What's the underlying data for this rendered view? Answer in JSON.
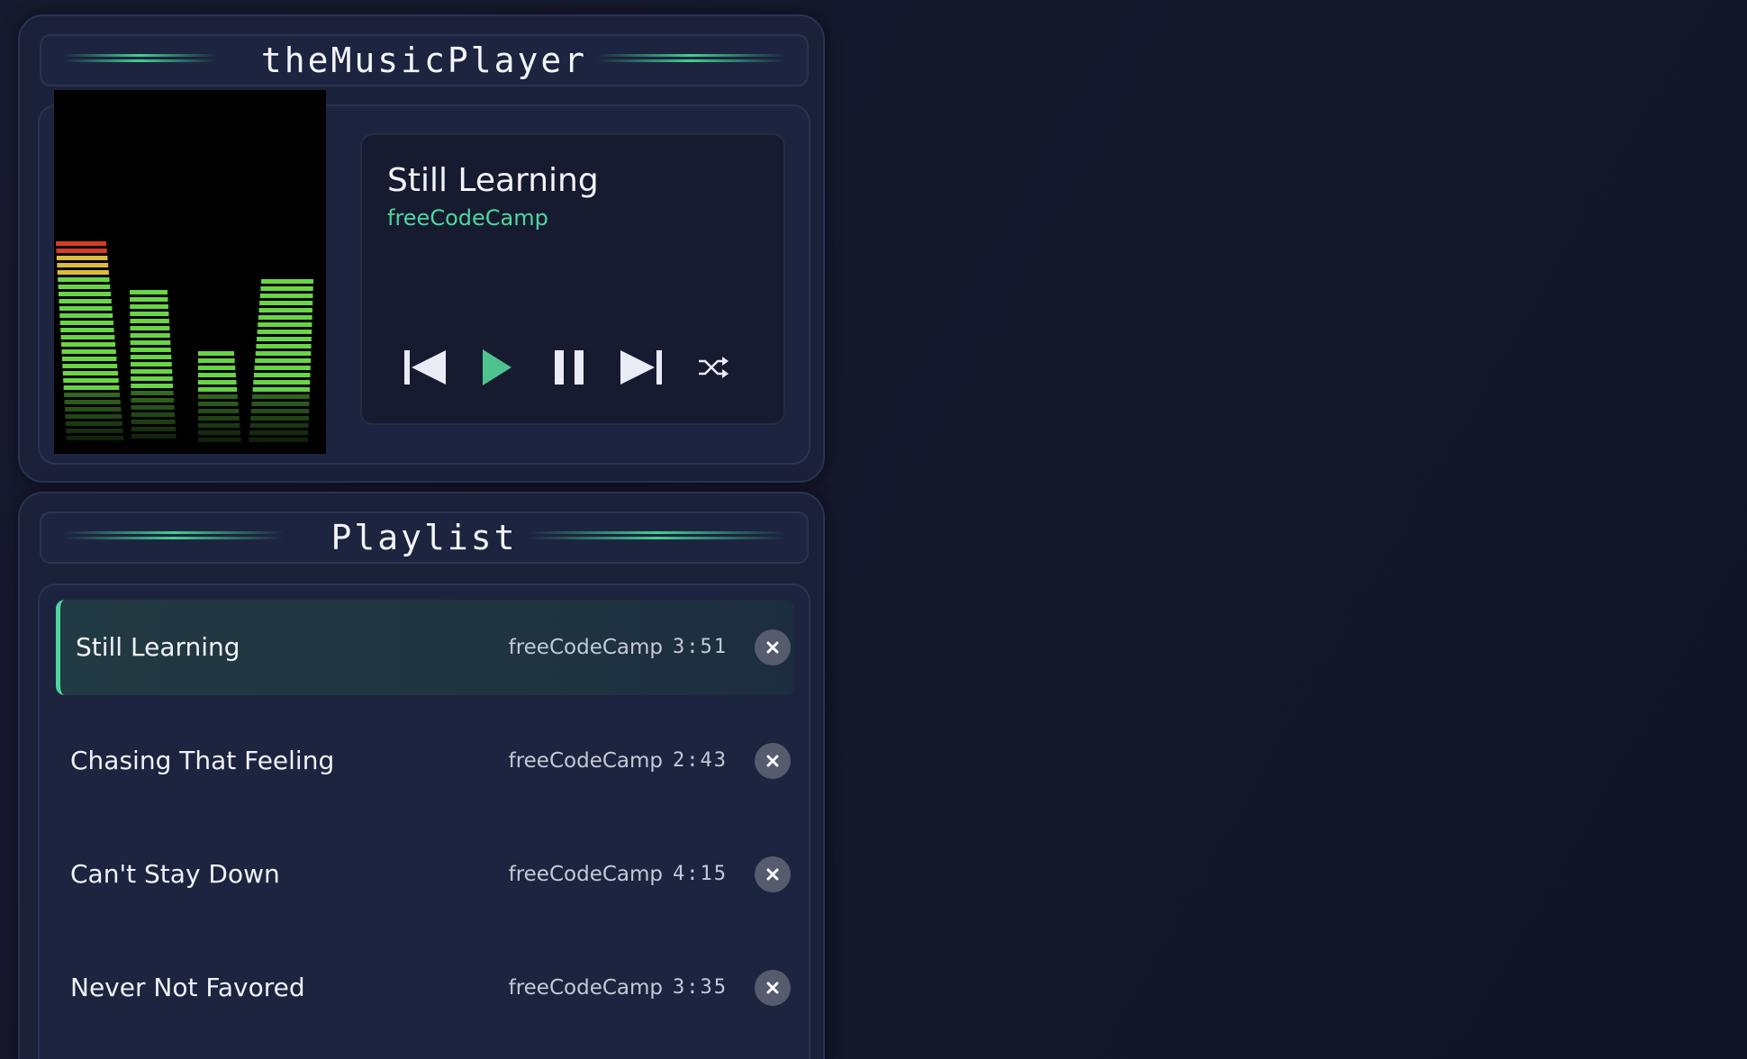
{
  "player": {
    "title": "theMusicPlayer",
    "now_playing": {
      "title": "Still Learning",
      "artist": "freeCodeCamp"
    },
    "controls": {
      "previous_icon": "skip-previous-icon",
      "play_icon": "play-icon",
      "pause_icon": "pause-icon",
      "next_icon": "skip-next-icon",
      "shuffle_icon": "shuffle-icon"
    },
    "colors": {
      "accent": "#4fd6a0",
      "background": "#15172a",
      "card": "#1b2138"
    }
  },
  "playlist": {
    "title": "Playlist",
    "items": [
      {
        "title": "Still Learning",
        "artist": "freeCodeCamp",
        "duration": "3:51",
        "active": true
      },
      {
        "title": "Chasing That Feeling",
        "artist": "freeCodeCamp",
        "duration": "2:43",
        "active": false
      },
      {
        "title": "Can't Stay Down",
        "artist": "freeCodeCamp",
        "duration": "4:15",
        "active": false
      },
      {
        "title": "Never Not Favored",
        "artist": "freeCodeCamp",
        "duration": "3:35",
        "active": false
      }
    ]
  }
}
